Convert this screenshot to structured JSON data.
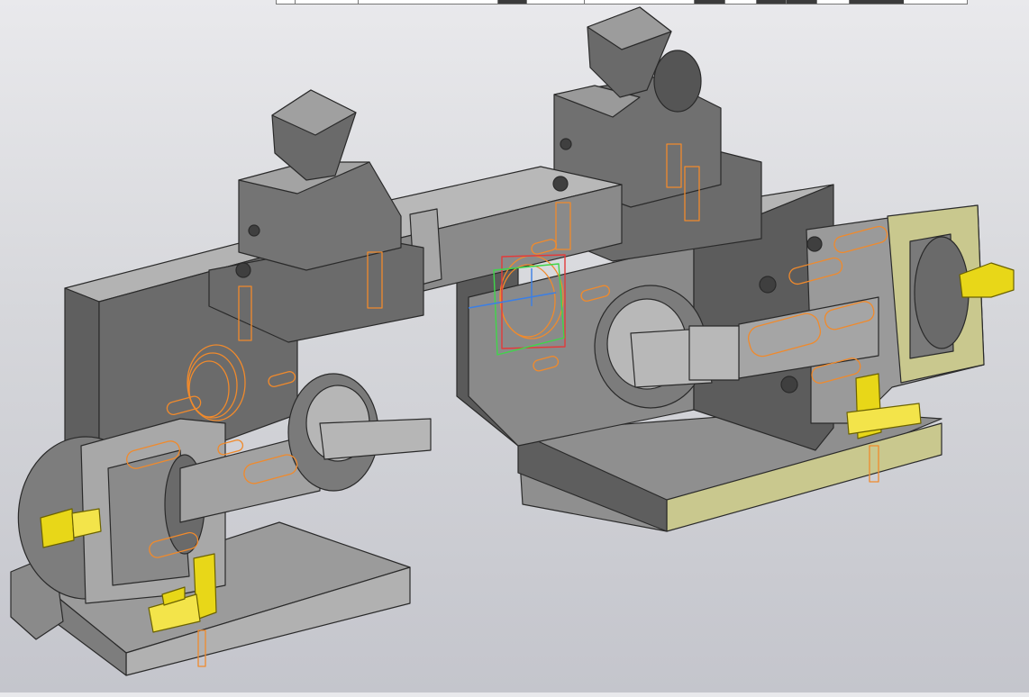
{
  "viewport": {
    "background_top": "#e9e9ec",
    "background_bottom": "#c4c5cc"
  },
  "colors": {
    "face_light": "#a9a9a9",
    "face_mid": "#8c8c8c",
    "face_dark": "#6a6a6a",
    "face_darker": "#4f4f4f",
    "edge": "#2a2a2a",
    "hidden_edges": "#f08a2c",
    "fitting": "#e8d718",
    "section_highlight": "#c9c88e",
    "axis_green": "#3fd64a",
    "axis_red": "#e23b3b",
    "axis_blue": "#3a7fe6"
  },
  "scene": {
    "parts": [
      "left-fixture",
      "right-fixture",
      "connecting-rail",
      "left-clamp",
      "right-clamp",
      "left-chuck",
      "right-chuck",
      "left-fitting",
      "right-fitting",
      "origin-triad"
    ]
  }
}
